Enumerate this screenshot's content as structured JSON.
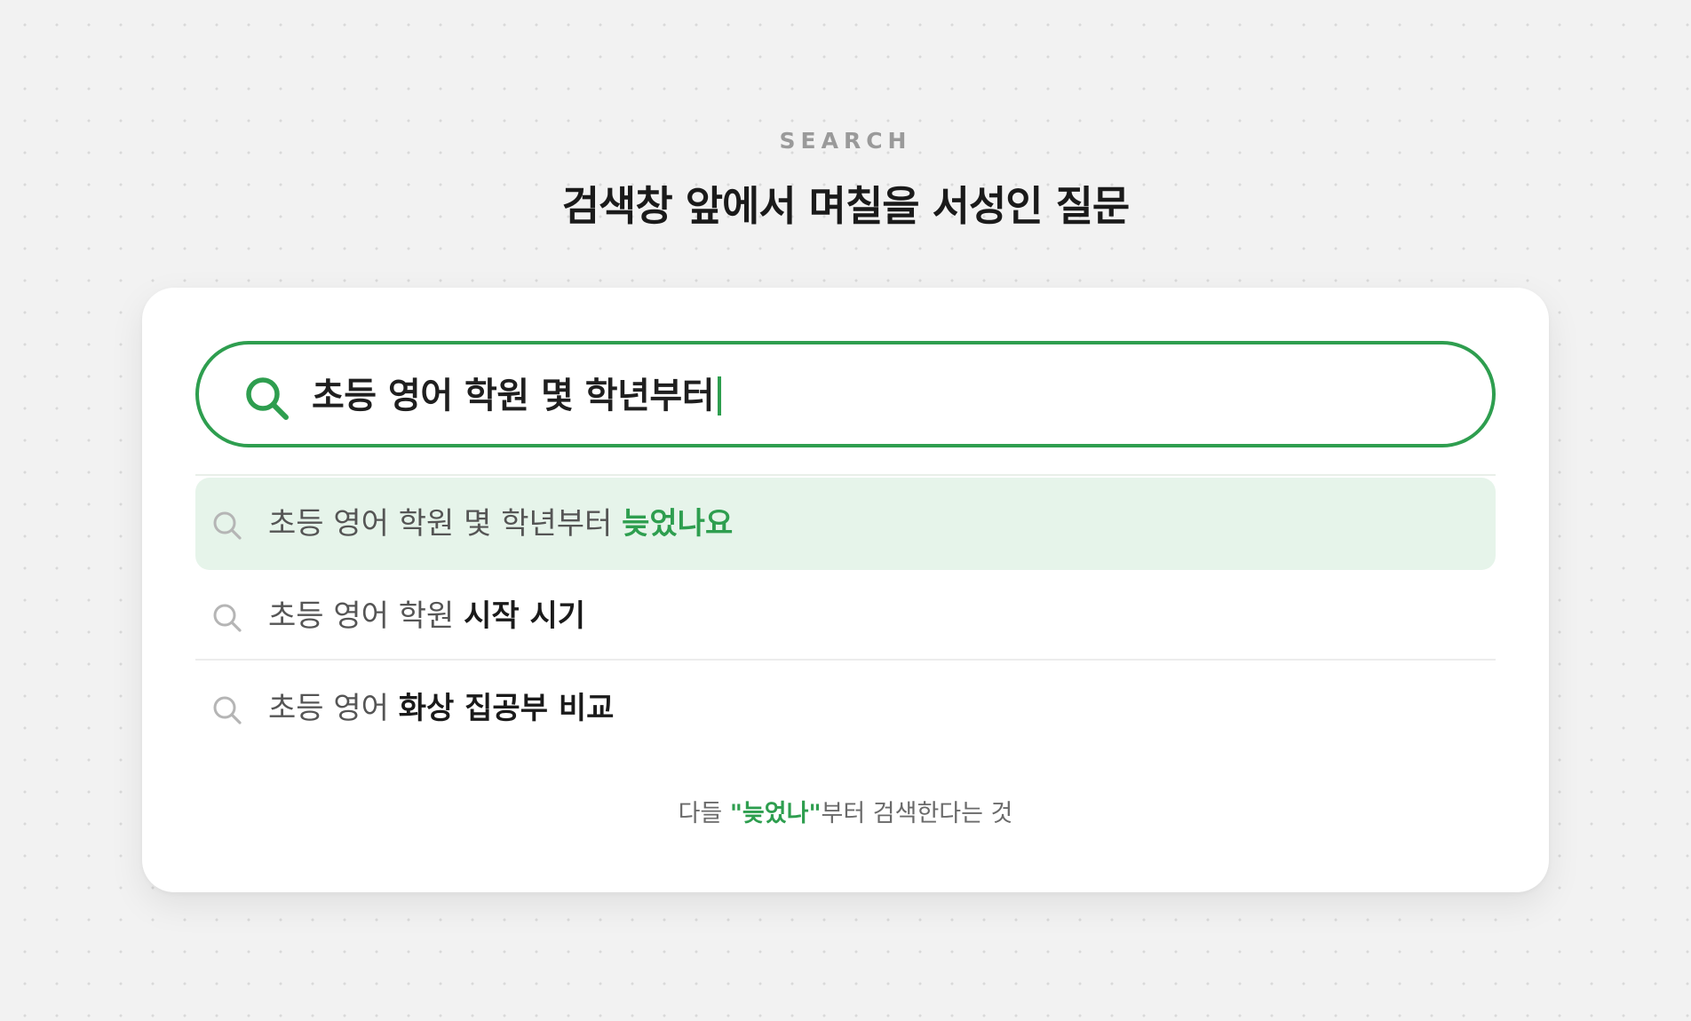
{
  "header": {
    "eyebrow": "SEARCH",
    "title": "검색창 앞에서 며칠을 서성인 질문"
  },
  "search": {
    "query": "초등 영어 학원 몇 학년부터",
    "icon": "search-icon",
    "accent_color": "#2e9e4f"
  },
  "suggestions": [
    {
      "prefix": "초등 영어 학원 몇 학년부터 ",
      "highlight": "늦었나요",
      "active": true
    },
    {
      "prefix": "초등 영어 학원 ",
      "highlight": "시작 시기",
      "active": false
    },
    {
      "prefix": "초등 영어 ",
      "highlight": "화상 집공부 비교",
      "active": false
    }
  ],
  "footnote": {
    "before": "다들 ",
    "highlight": "\"늦었나\"",
    "after": "부터 검색한다는 것"
  }
}
